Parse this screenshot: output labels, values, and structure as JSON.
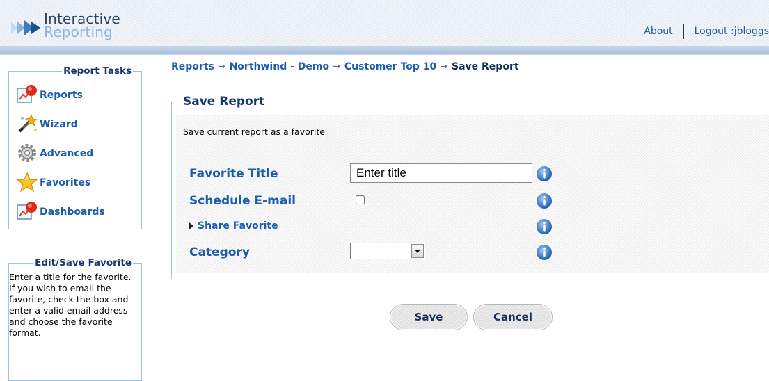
{
  "header": {
    "logo_line1": "Interactive",
    "logo_line2": "Reporting",
    "about_link": "About",
    "logout_link": "Logout :jbloggs"
  },
  "sidebar": {
    "tasks_title": "Report Tasks",
    "tasks": [
      {
        "label": "Reports",
        "icon": "reports-icon"
      },
      {
        "label": "Wizard",
        "icon": "wizard-icon"
      },
      {
        "label": "Advanced",
        "icon": "gear-icon"
      },
      {
        "label": "Favorites",
        "icon": "star-icon"
      },
      {
        "label": "Dashboards",
        "icon": "dashboards-icon"
      }
    ],
    "help_title": "Edit/Save Favorite",
    "help_text": "Enter a title for the favorite. If you wish to email the favorite, check the box and enter a valid email address and choose the favorite format."
  },
  "breadcrumb": {
    "items": [
      "Reports",
      "Northwind - Demo",
      "Customer Top 10"
    ],
    "current": "Save Report",
    "separator": "➙"
  },
  "form": {
    "legend": "Save Report",
    "description": "Save current report as a favorite",
    "favorite_title_label": "Favorite Title",
    "favorite_title_value": "Enter title",
    "schedule_email_label": "Schedule E-mail",
    "schedule_email_checked": false,
    "share_favorite_label": "Share Favorite",
    "category_label": "Category",
    "category_value": ""
  },
  "actions": {
    "save_label": "Save",
    "cancel_label": "Cancel"
  },
  "colors": {
    "link": "#1b5cad",
    "heading": "#153a6b",
    "panel_border": "#9fc3e6",
    "info_icon": "#2f6fc4"
  }
}
